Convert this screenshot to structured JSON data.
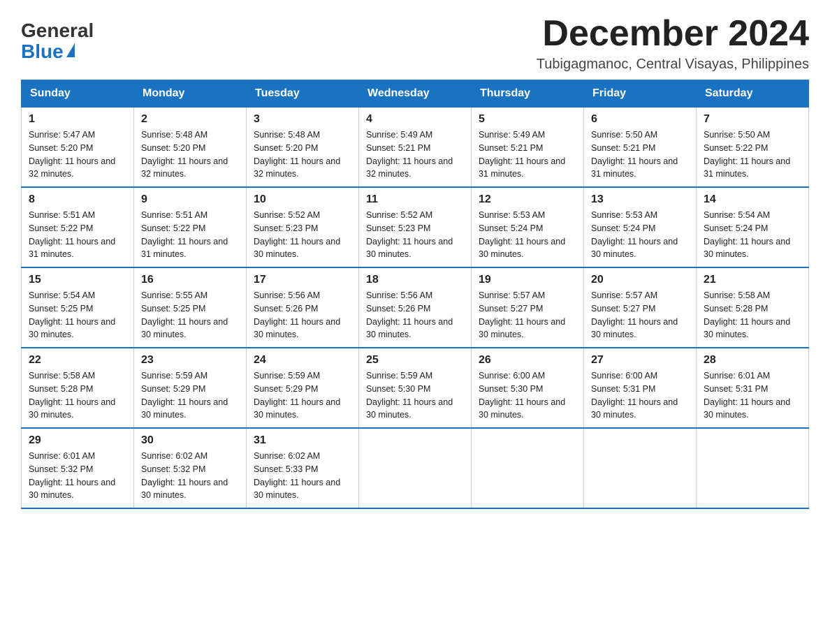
{
  "logo": {
    "general": "General",
    "blue": "Blue"
  },
  "title": "December 2024",
  "subtitle": "Tubigagmanoc, Central Visayas, Philippines",
  "headers": [
    "Sunday",
    "Monday",
    "Tuesday",
    "Wednesday",
    "Thursday",
    "Friday",
    "Saturday"
  ],
  "weeks": [
    [
      {
        "day": "1",
        "sunrise": "5:47 AM",
        "sunset": "5:20 PM",
        "daylight": "11 hours and 32 minutes."
      },
      {
        "day": "2",
        "sunrise": "5:48 AM",
        "sunset": "5:20 PM",
        "daylight": "11 hours and 32 minutes."
      },
      {
        "day": "3",
        "sunrise": "5:48 AM",
        "sunset": "5:20 PM",
        "daylight": "11 hours and 32 minutes."
      },
      {
        "day": "4",
        "sunrise": "5:49 AM",
        "sunset": "5:21 PM",
        "daylight": "11 hours and 32 minutes."
      },
      {
        "day": "5",
        "sunrise": "5:49 AM",
        "sunset": "5:21 PM",
        "daylight": "11 hours and 31 minutes."
      },
      {
        "day": "6",
        "sunrise": "5:50 AM",
        "sunset": "5:21 PM",
        "daylight": "11 hours and 31 minutes."
      },
      {
        "day": "7",
        "sunrise": "5:50 AM",
        "sunset": "5:22 PM",
        "daylight": "11 hours and 31 minutes."
      }
    ],
    [
      {
        "day": "8",
        "sunrise": "5:51 AM",
        "sunset": "5:22 PM",
        "daylight": "11 hours and 31 minutes."
      },
      {
        "day": "9",
        "sunrise": "5:51 AM",
        "sunset": "5:22 PM",
        "daylight": "11 hours and 31 minutes."
      },
      {
        "day": "10",
        "sunrise": "5:52 AM",
        "sunset": "5:23 PM",
        "daylight": "11 hours and 30 minutes."
      },
      {
        "day": "11",
        "sunrise": "5:52 AM",
        "sunset": "5:23 PM",
        "daylight": "11 hours and 30 minutes."
      },
      {
        "day": "12",
        "sunrise": "5:53 AM",
        "sunset": "5:24 PM",
        "daylight": "11 hours and 30 minutes."
      },
      {
        "day": "13",
        "sunrise": "5:53 AM",
        "sunset": "5:24 PM",
        "daylight": "11 hours and 30 minutes."
      },
      {
        "day": "14",
        "sunrise": "5:54 AM",
        "sunset": "5:24 PM",
        "daylight": "11 hours and 30 minutes."
      }
    ],
    [
      {
        "day": "15",
        "sunrise": "5:54 AM",
        "sunset": "5:25 PM",
        "daylight": "11 hours and 30 minutes."
      },
      {
        "day": "16",
        "sunrise": "5:55 AM",
        "sunset": "5:25 PM",
        "daylight": "11 hours and 30 minutes."
      },
      {
        "day": "17",
        "sunrise": "5:56 AM",
        "sunset": "5:26 PM",
        "daylight": "11 hours and 30 minutes."
      },
      {
        "day": "18",
        "sunrise": "5:56 AM",
        "sunset": "5:26 PM",
        "daylight": "11 hours and 30 minutes."
      },
      {
        "day": "19",
        "sunrise": "5:57 AM",
        "sunset": "5:27 PM",
        "daylight": "11 hours and 30 minutes."
      },
      {
        "day": "20",
        "sunrise": "5:57 AM",
        "sunset": "5:27 PM",
        "daylight": "11 hours and 30 minutes."
      },
      {
        "day": "21",
        "sunrise": "5:58 AM",
        "sunset": "5:28 PM",
        "daylight": "11 hours and 30 minutes."
      }
    ],
    [
      {
        "day": "22",
        "sunrise": "5:58 AM",
        "sunset": "5:28 PM",
        "daylight": "11 hours and 30 minutes."
      },
      {
        "day": "23",
        "sunrise": "5:59 AM",
        "sunset": "5:29 PM",
        "daylight": "11 hours and 30 minutes."
      },
      {
        "day": "24",
        "sunrise": "5:59 AM",
        "sunset": "5:29 PM",
        "daylight": "11 hours and 30 minutes."
      },
      {
        "day": "25",
        "sunrise": "5:59 AM",
        "sunset": "5:30 PM",
        "daylight": "11 hours and 30 minutes."
      },
      {
        "day": "26",
        "sunrise": "6:00 AM",
        "sunset": "5:30 PM",
        "daylight": "11 hours and 30 minutes."
      },
      {
        "day": "27",
        "sunrise": "6:00 AM",
        "sunset": "5:31 PM",
        "daylight": "11 hours and 30 minutes."
      },
      {
        "day": "28",
        "sunrise": "6:01 AM",
        "sunset": "5:31 PM",
        "daylight": "11 hours and 30 minutes."
      }
    ],
    [
      {
        "day": "29",
        "sunrise": "6:01 AM",
        "sunset": "5:32 PM",
        "daylight": "11 hours and 30 minutes."
      },
      {
        "day": "30",
        "sunrise": "6:02 AM",
        "sunset": "5:32 PM",
        "daylight": "11 hours and 30 minutes."
      },
      {
        "day": "31",
        "sunrise": "6:02 AM",
        "sunset": "5:33 PM",
        "daylight": "11 hours and 30 minutes."
      },
      null,
      null,
      null,
      null
    ]
  ],
  "labels": {
    "sunrise": "Sunrise:",
    "sunset": "Sunset:",
    "daylight": "Daylight:"
  }
}
